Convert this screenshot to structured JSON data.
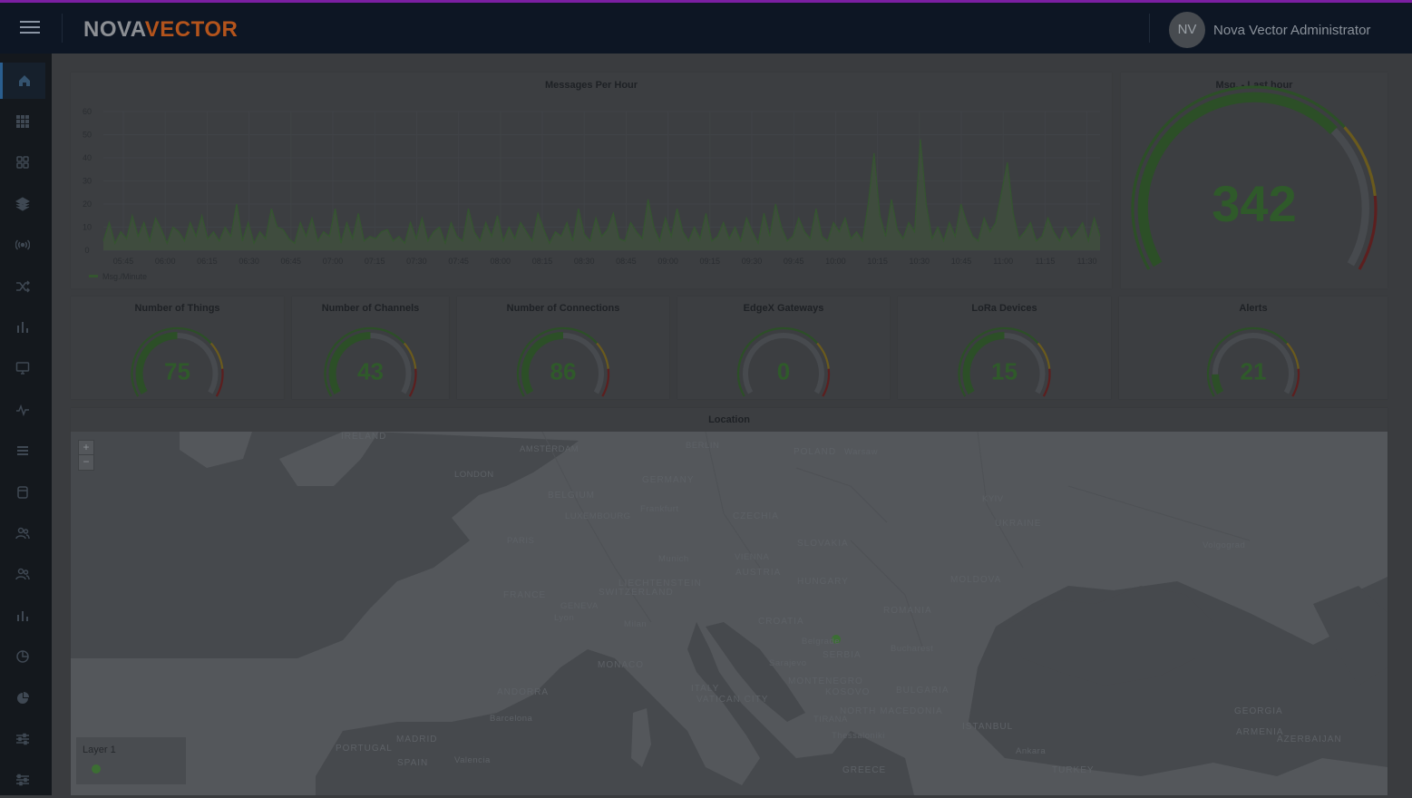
{
  "header": {
    "logo_part1": "NOVA",
    "logo_part2": "VECTOR",
    "avatar_initials": "NV",
    "user_name": "Nova Vector Administrator"
  },
  "sidebar": {
    "items": [
      {
        "icon": "home-icon",
        "active": true
      },
      {
        "icon": "grid-icon"
      },
      {
        "icon": "apps-icon"
      },
      {
        "icon": "layers-icon"
      },
      {
        "icon": "broadcast-icon"
      },
      {
        "icon": "shuffle-icon"
      },
      {
        "icon": "bar-chart-icon"
      },
      {
        "icon": "monitor-icon"
      },
      {
        "icon": "activity-icon"
      },
      {
        "icon": "list-icon"
      },
      {
        "icon": "database-icon"
      },
      {
        "icon": "users-icon"
      },
      {
        "icon": "user-group-icon"
      },
      {
        "icon": "stats-icon"
      },
      {
        "icon": "pie-outline-icon"
      },
      {
        "icon": "pie-chart-icon"
      },
      {
        "icon": "sliders-icon"
      },
      {
        "icon": "settings-sliders-icon"
      }
    ]
  },
  "chart_data": {
    "type": "area",
    "title": "Messages Per Hour",
    "legend": [
      "Msg./Minute"
    ],
    "ylim": [
      0,
      60
    ],
    "yticks": [
      "0",
      "10",
      "20",
      "30",
      "40",
      "50",
      "60"
    ],
    "xticks": [
      "05:45",
      "06:00",
      "06:15",
      "06:30",
      "06:45",
      "07:00",
      "07:15",
      "07:30",
      "07:45",
      "08:00",
      "08:15",
      "08:30",
      "08:45",
      "09:00",
      "09:15",
      "09:30",
      "09:45",
      "10:00",
      "10:15",
      "10:30",
      "10:45",
      "11:00",
      "11:15",
      "11:30"
    ],
    "grid": true,
    "series": [
      {
        "name": "Msg./Minute",
        "values": [
          4,
          12,
          3,
          8,
          5,
          15,
          6,
          12,
          4,
          14,
          9,
          3,
          10,
          8,
          4,
          12,
          6,
          15,
          5,
          8,
          4,
          10,
          6,
          20,
          4,
          12,
          3,
          8,
          5,
          18,
          10,
          9,
          5,
          3,
          12,
          6,
          14,
          4,
          8,
          6,
          18,
          3,
          12,
          5,
          16,
          4,
          6,
          5,
          8,
          9,
          4,
          6,
          3,
          12,
          5,
          14,
          4,
          8,
          10,
          3,
          12,
          6,
          4,
          18,
          8,
          4,
          12,
          6,
          15,
          4,
          10,
          5,
          12,
          8,
          4,
          16,
          9,
          3,
          8,
          6,
          12,
          4,
          18,
          7,
          4,
          14,
          6,
          9,
          16,
          5,
          4,
          12,
          8,
          5,
          22,
          10,
          4,
          14,
          6,
          18,
          8,
          4,
          10,
          5,
          16,
          4,
          6,
          12,
          5,
          10,
          4,
          14,
          8,
          3,
          16,
          6,
          20,
          10,
          4,
          6,
          14,
          8,
          5,
          18,
          6,
          4,
          12,
          8,
          14,
          5,
          8,
          4,
          20,
          42,
          15,
          6,
          22,
          9,
          5,
          12,
          8,
          48,
          20,
          5,
          10,
          4,
          12,
          6,
          20,
          12,
          6,
          4,
          14,
          8,
          12,
          25,
          38,
          16,
          5,
          8,
          12,
          4,
          6,
          14,
          8,
          4,
          10,
          5,
          8,
          12,
          4,
          14,
          6
        ]
      }
    ]
  },
  "msg_last_hour": {
    "title": "Msg. - Last hour",
    "value": "342",
    "fraction": 0.69
  },
  "stats": [
    {
      "title": "Number of Things",
      "value": "75",
      "fraction": 0.5
    },
    {
      "title": "Number of Channels",
      "value": "43",
      "fraction": 0.5
    },
    {
      "title": "Number of Connections",
      "value": "86",
      "fraction": 0.5
    },
    {
      "title": "EdgeX Gateways",
      "value": "0",
      "fraction": 0.0
    },
    {
      "title": "LoRa Devices",
      "value": "15",
      "fraction": 0.5
    },
    {
      "title": "Alerts",
      "value": "21",
      "fraction": 0.12
    }
  ],
  "gauge_colors": {
    "green": "#2c4f27",
    "yellow": "#6a5a1d",
    "red": "#5c1f1f",
    "track": "#474a4e"
  },
  "location": {
    "title": "Location",
    "zoom_in": "+",
    "zoom_out": "−",
    "layer_label": "Layer 1",
    "labels": {
      "ireland": "IRELAND",
      "london": "LONDON",
      "amsterdam": "AMSTERDAM",
      "berlin": "BERLIN",
      "poland": "POLAND",
      "warsaw": "Warsaw",
      "germany": "GERMANY",
      "belgium": "BELGIUM",
      "luxembourg": "LUXEMBOURG",
      "frankfurt": "Frankfurt",
      "czechia": "CZECHIA",
      "kyiv": "KYIV",
      "ukraine": "UKRAINE",
      "volgograd": "Volgograd",
      "paris": "PARIS",
      "munich": "Munich",
      "slovakia": "SLOVAKIA",
      "vienna": "VIENNA",
      "austria": "AUSTRIA",
      "liechtenstein": "LIECHTENSTEIN",
      "switzerland": "SWITZERLAND",
      "france": "FRANCE",
      "geneva": "GENEVA",
      "lyon": "Lyon",
      "hungary": "HUNGARY",
      "moldova": "MOLDOVA",
      "romania": "ROMANIA",
      "croatia": "CROATIA",
      "milan": "Milan",
      "belgrade": "Belgrade",
      "serbia": "SERBIA",
      "bucharest": "Bucharest",
      "monaco": "MONACO",
      "sarajevo": "Sarajevo",
      "montenegro": "MONTENEGRO",
      "kosovo": "KOSOVO",
      "andorra": "ANDORRA",
      "italy": "ITALY",
      "bulgaria": "BULGARIA",
      "north_macedonia": "NORTH MACEDONIA",
      "barcelona": "Barcelona",
      "madrid": "MADRID",
      "portugal": "PORTUGAL",
      "spain": "SPAIN",
      "valencia": "Valencia",
      "istanbul": "ISTANBUL",
      "ankara": "Ankara",
      "georgia": "GEORGIA",
      "armenia": "ARMENIA",
      "azerbaijan": "AZERBAIJAN",
      "turkey": "TURKEY",
      "greece": "GREECE",
      "thessaloniki": "Thessaloniki",
      "tirana": "TIRANA",
      "vatican_city": "VATICAN CITY"
    }
  }
}
